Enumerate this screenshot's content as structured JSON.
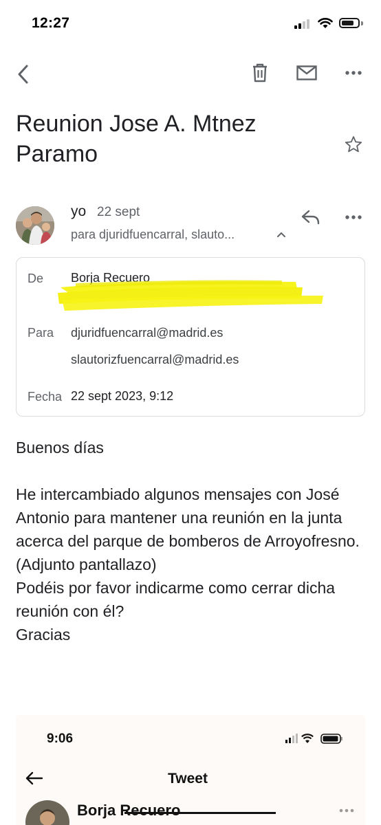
{
  "status_bar": {
    "time": "12:27"
  },
  "toolbar": {
    "back_icon": "chevron-left-icon",
    "delete_icon": "trash-icon",
    "mail_icon": "mail-icon",
    "more_icon": "more-horizontal-icon"
  },
  "email": {
    "subject": "Reunion Jose A. Mtnez Paramo",
    "sender_short": "yo",
    "date_short": "22 sept",
    "recipients_summary": "para djuridfuencarral, slauto...",
    "details": {
      "from_label": "De",
      "from_value": "Borja Recuero",
      "to_label": "Para",
      "to_values": [
        "djuridfuencarral@madrid.es",
        "slautorizfuencarral@madrid.es"
      ],
      "date_label": "Fecha",
      "date_value": "22 sept 2023, 9:12"
    },
    "body": {
      "greeting": "Buenos días",
      "paragraph": "He intercambiado algunos mensajes con José Antonio para mantener una reunión en la junta acerca del parque de bomberos de Arroyofresno. (Adjunto pantallazo)",
      "question": "Podéis por favor indicarme como cerrar dicha reunión con él?",
      "closing": "Gracias"
    }
  },
  "embedded_screenshot": {
    "time": "9:06",
    "title": "Tweet",
    "author": "Borja Recuero"
  },
  "colors": {
    "highlight": "#f7f20a",
    "text": "#202124",
    "secondary": "#5f6368",
    "border": "#dadce0"
  }
}
